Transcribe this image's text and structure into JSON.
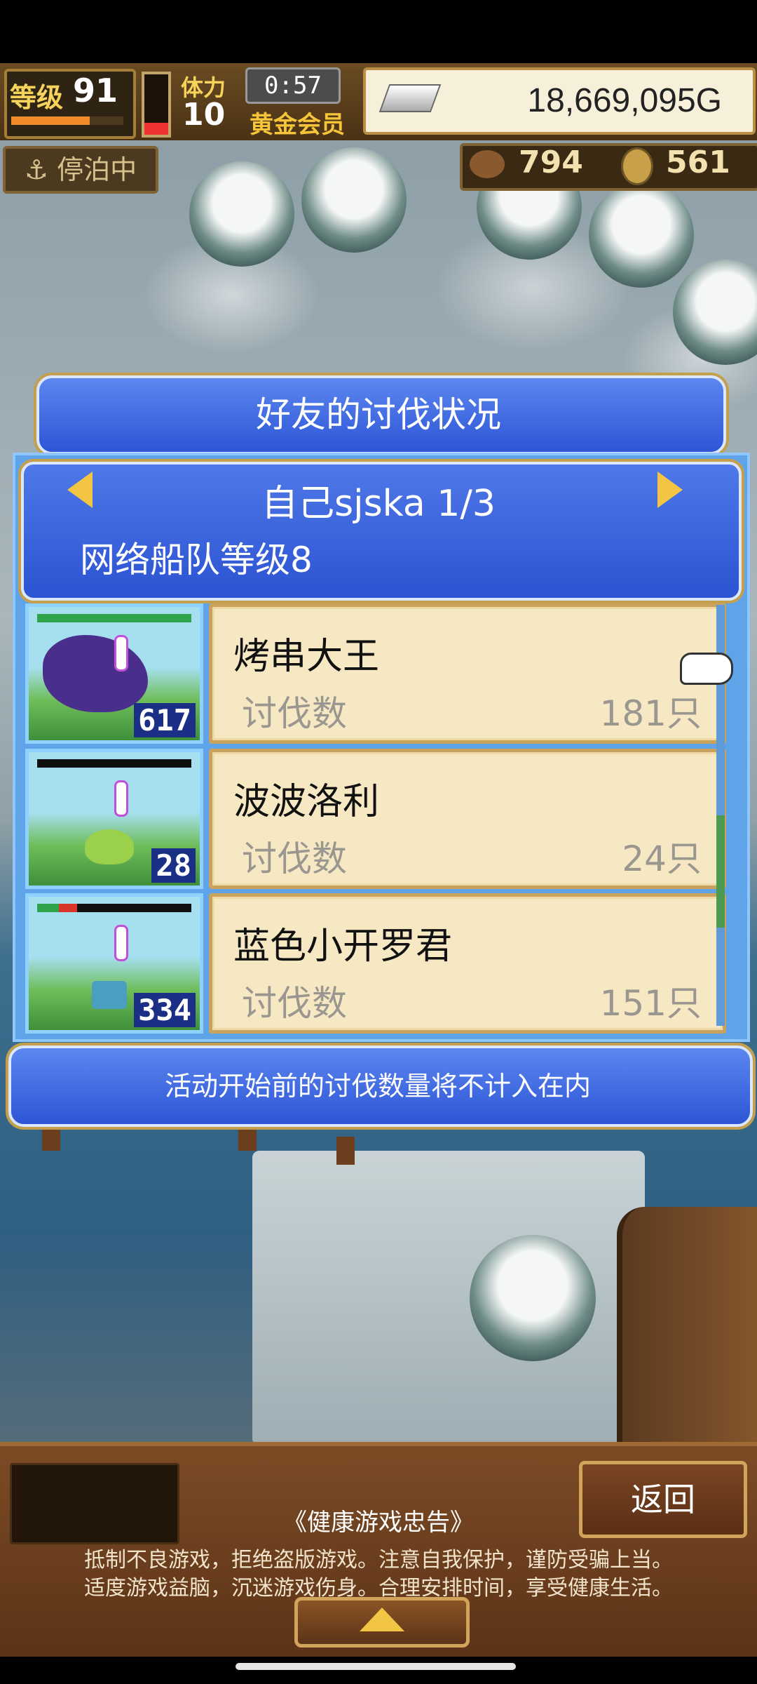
{
  "hud": {
    "level_label": "等级",
    "level_value": "91",
    "stamina_label": "体力",
    "stamina_value": "10",
    "timer": "0:57",
    "membership": "黄金会员",
    "money": "18,669,095G",
    "dock_status": "停泊中",
    "resource_1": "794",
    "resource_2": "561"
  },
  "dialog": {
    "title": "好友的讨伐状况",
    "player": "自己sjska 1/3",
    "fleet_level": "网络船队等级8",
    "rows": [
      {
        "name": "烤串大王",
        "label": "讨伐数",
        "count": "181只",
        "badge": "617",
        "hp_color": "#d9352b"
      },
      {
        "name": "波波洛利",
        "label": "讨伐数",
        "count": "24只",
        "badge": "28",
        "hp_color": "#111111"
      },
      {
        "name": "蓝色小开罗君",
        "label": "讨伐数",
        "count": "151只",
        "badge": "334",
        "hp_color": "#d9352b"
      }
    ],
    "notice": "活动开始前的讨伐数量将不计入在内"
  },
  "bottom": {
    "back_label": "返回",
    "health_title": "《健康游戏忠告》",
    "health_line1": "抵制不良游戏，拒绝盗版游戏。注意自我保护，谨防受骗上当。",
    "health_line2": "适度游戏益脑，沉迷游戏伤身。合理安排时间，享受健康生活。"
  }
}
